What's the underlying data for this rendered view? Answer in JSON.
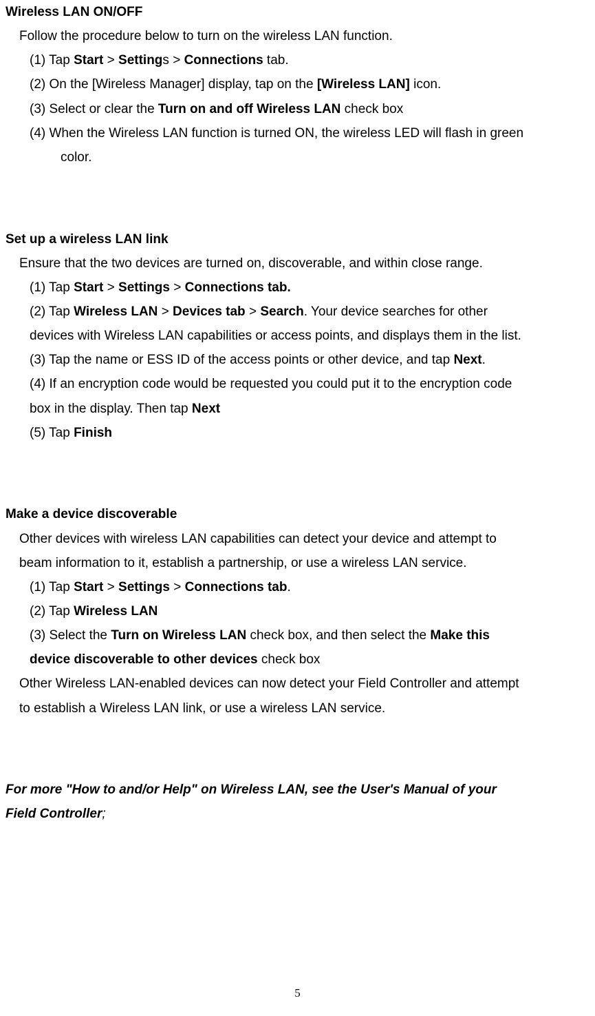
{
  "section1": {
    "title": "Wireless LAN ON/OFF",
    "intro": "Follow the procedure below to turn on the wireless LAN function.",
    "s1_pre": "(1) Tap ",
    "s1_b1": "Start",
    "s1_g1": " > ",
    "s1_b2": "Setting",
    "s1_mid": "s > ",
    "s1_b3": "Connections",
    "s1_end": " tab.",
    "s2_pre": "(2) On the [Wireless Manager] display, tap on the ",
    "s2_b1": "[Wireless LAN]",
    "s2_end": " icon.",
    "s3_pre": "(3) Select or clear the ",
    "s3_b1": "Turn on and off Wireless LAN",
    "s3_end": " check box",
    "s4_line": "(4) When the Wireless LAN function is turned ON, the wireless LED will flash in green",
    "s4_cont": "color."
  },
  "section2": {
    "title": "Set up a wireless LAN link",
    "intro": "Ensure that the two devices are turned on, discoverable, and within close range.",
    "s1_pre": "(1) Tap ",
    "s1_b1": "Start",
    "s1_g1": " > ",
    "s1_b2": "Settings",
    "s1_g2": " > ",
    "s1_b3": "Connections tab.",
    "s2_pre": "(2) Tap ",
    "s2_b1": "Wireless LAN",
    "s2_g1": " > ",
    "s2_b2": "Devices tab",
    "s2_g2": " > ",
    "s2_b3": "Search",
    "s2_end": ". Your device searches for other",
    "s2_cont": "devices with Wireless LAN capabilities or access points, and displays them in the list.",
    "s3_pre": "(3) Tap the name or ESS ID of the access points or other device, and tap ",
    "s3_b1": "Next",
    "s3_end": ".",
    "s4_line": "(4) If an encryption code would be requested you could put it to the encryption code",
    "s4_cont_pre": "box in the display. Then tap ",
    "s4_cont_b": "Next",
    "s5_pre": "(5) Tap ",
    "s5_b": "Finish"
  },
  "section3": {
    "title": "Make a device discoverable",
    "intro1": "Other devices with wireless LAN capabilities can detect your device and attempt to",
    "intro2": "beam information to it, establish a partnership, or use a wireless LAN service.",
    "s1_pre": "(1) Tap ",
    "s1_b1": "Start",
    "s1_g1": " > ",
    "s1_b2": "Settings",
    "s1_g2": " > ",
    "s1_b3": "Connections tab",
    "s1_end": ".",
    "s2_pre": "(2) Tap ",
    "s2_b1": "Wireless LAN",
    "s3_pre": "(3) Select the ",
    "s3_b1": "Turn on Wireless LAN",
    "s3_mid": " check box, and then select the ",
    "s3_b2": "Make this",
    "s3_cont_b": "device discoverable to other devices",
    "s3_cont_end": " check box",
    "outro1": "Other Wireless LAN-enabled devices can now detect your Field Controller and attempt",
    "outro2": "to establish a Wireless LAN link, or use a wireless LAN service."
  },
  "footer": {
    "line1": "For more \"How to and/or Help\" on Wireless LAN, see the User's Manual of your",
    "line2_b": "Field Controller",
    "line2_end": ";"
  },
  "page_number": "5"
}
